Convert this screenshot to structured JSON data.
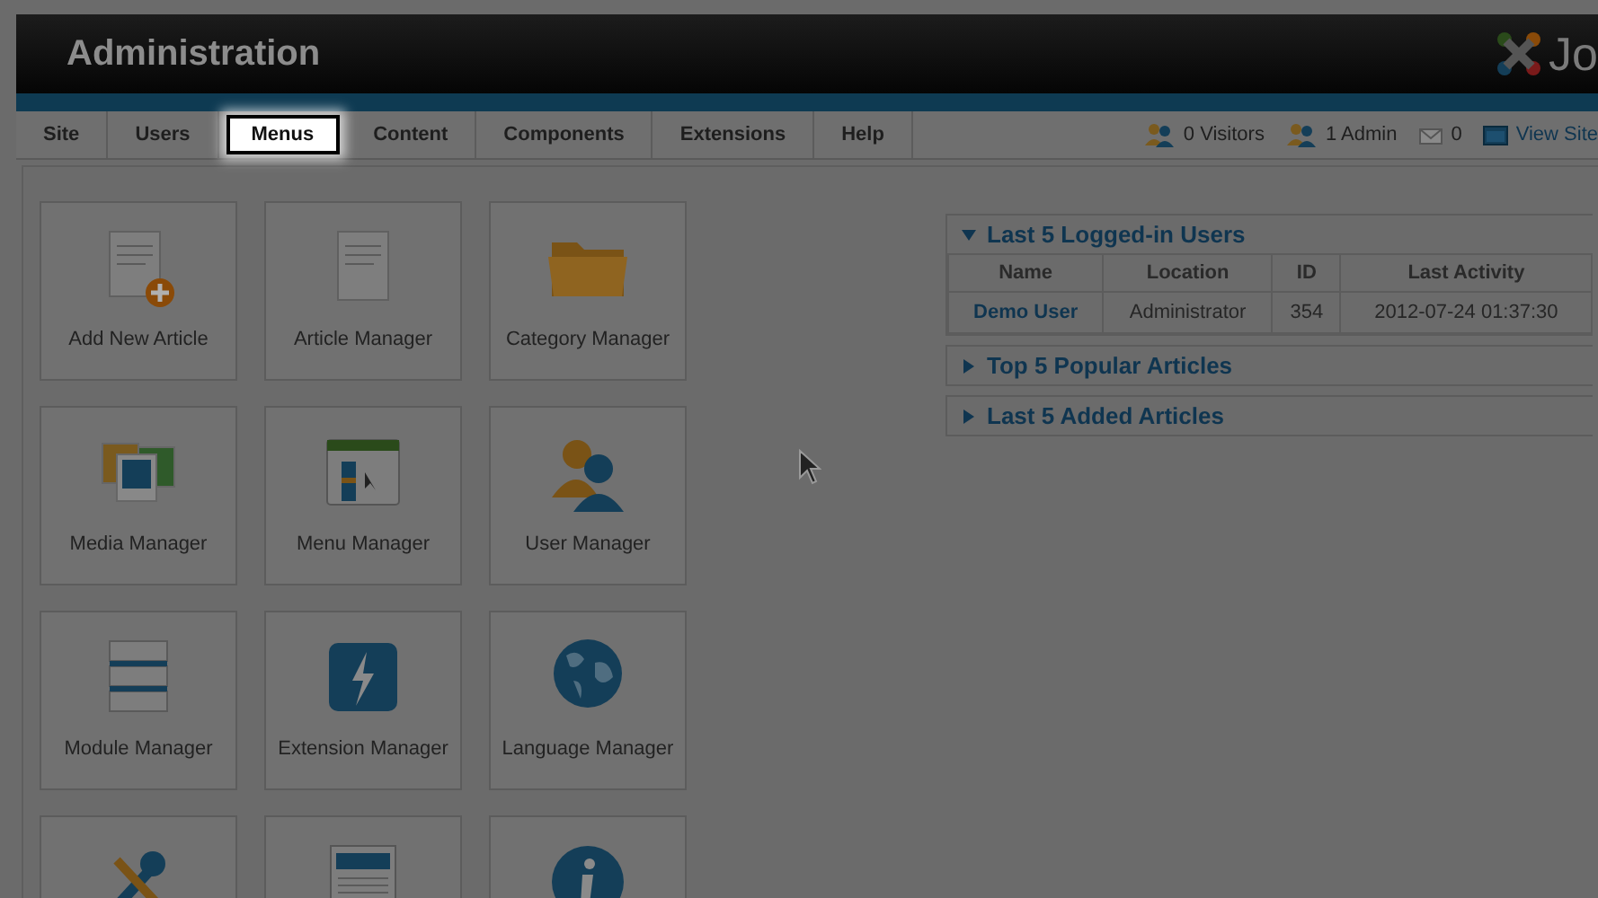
{
  "header": {
    "title": "Administration",
    "logo_text": "Jo"
  },
  "menu": [
    {
      "label": "Site",
      "selected": false
    },
    {
      "label": "Users",
      "selected": false
    },
    {
      "label": "Menus",
      "selected": true
    },
    {
      "label": "Content",
      "selected": false
    },
    {
      "label": "Components",
      "selected": false
    },
    {
      "label": "Extensions",
      "selected": false
    },
    {
      "label": "Help",
      "selected": false
    }
  ],
  "status": [
    {
      "kind": "visitors",
      "text": "0 Visitors"
    },
    {
      "kind": "admins",
      "text": "1 Admin"
    },
    {
      "kind": "messages",
      "text": "0"
    },
    {
      "kind": "site",
      "text": "View Site"
    }
  ],
  "quickicons": [
    {
      "kind": "addarticle",
      "label": "Add New Article"
    },
    {
      "kind": "article",
      "label": "Article Manager"
    },
    {
      "kind": "folder",
      "label": "Category Manager"
    },
    {
      "kind": "media",
      "label": "Media Manager"
    },
    {
      "kind": "menu",
      "label": "Menu Manager"
    },
    {
      "kind": "users",
      "label": "User Manager"
    },
    {
      "kind": "module",
      "label": "Module Manager"
    },
    {
      "kind": "bolt",
      "label": "Extension Manager"
    },
    {
      "kind": "globe",
      "label": "Language Manager"
    },
    {
      "kind": "tools"
    },
    {
      "kind": "template"
    },
    {
      "kind": "info"
    }
  ],
  "panels": [
    {
      "title": "Last 5 Logged-in Users",
      "expanded": true,
      "table": {
        "columns": [
          "Name",
          "Location",
          "ID",
          "Last Activity"
        ],
        "rows": [
          [
            "Demo User",
            "Administrator",
            "354",
            "2012-07-24 01:37:30"
          ]
        ]
      }
    },
    {
      "title": "Top 5 Popular Articles",
      "expanded": false
    },
    {
      "title": "Last 5 Added Articles",
      "expanded": false
    }
  ]
}
